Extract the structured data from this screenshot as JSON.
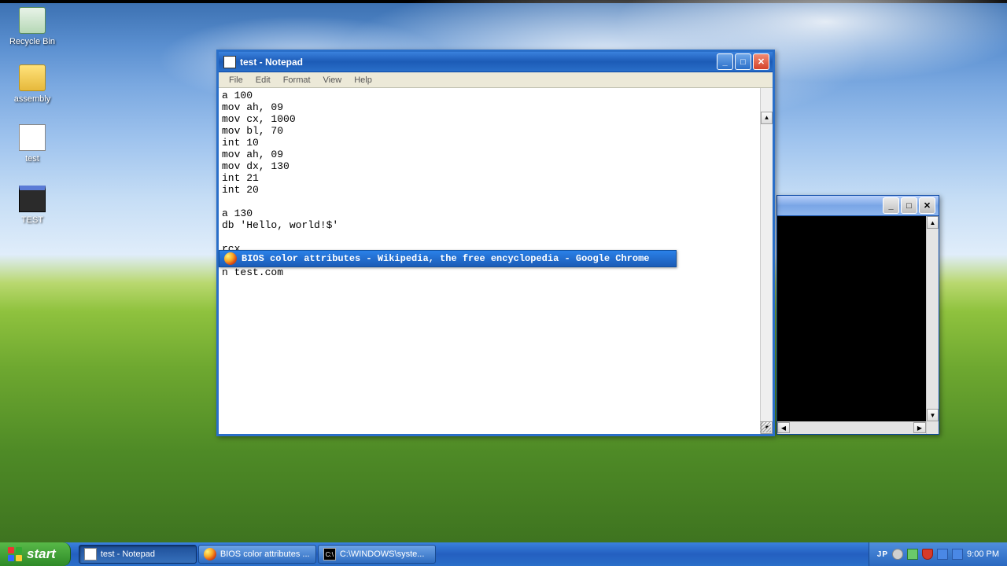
{
  "desktop": {
    "icons": {
      "recycle": "Recycle Bin",
      "folder": "assembly",
      "txt": "test",
      "exe": "TEST"
    }
  },
  "notepad": {
    "title": "test - Notepad",
    "menus": {
      "file": "File",
      "edit": "Edit",
      "format": "Format",
      "view": "View",
      "help": "Help"
    },
    "btn": {
      "min": "_",
      "max": "□",
      "close": "✕"
    },
    "content": "a 100\nmov ah, 09\nmov cx, 1000\nmov bl, 70\nint 10\nmov ah, 09\nmov dx, 130\nint 21\nint 20\n\na 130\ndb 'Hello, world!$'\n\nrcx\n300\nn test.com"
  },
  "alttab": {
    "label": "BIOS color attributes - Wikipedia, the free encyclopedia - Google Chrome"
  },
  "cmd": {
    "btn": {
      "min": "_",
      "max": "□",
      "close": "✕"
    },
    "arrows": {
      "up": "▲",
      "down": "▼",
      "left": "◀",
      "right": "▶"
    }
  },
  "taskbar": {
    "start": "start",
    "items": [
      {
        "label": "test - Notepad",
        "icon": "note",
        "active": true
      },
      {
        "label": "BIOS color attributes ...",
        "icon": "chrome",
        "active": false
      },
      {
        "label": "C:\\WINDOWS\\syste...",
        "icon": "cmd",
        "active": false
      }
    ],
    "tray": {
      "lang": "JP",
      "time": "9:00 PM"
    }
  }
}
